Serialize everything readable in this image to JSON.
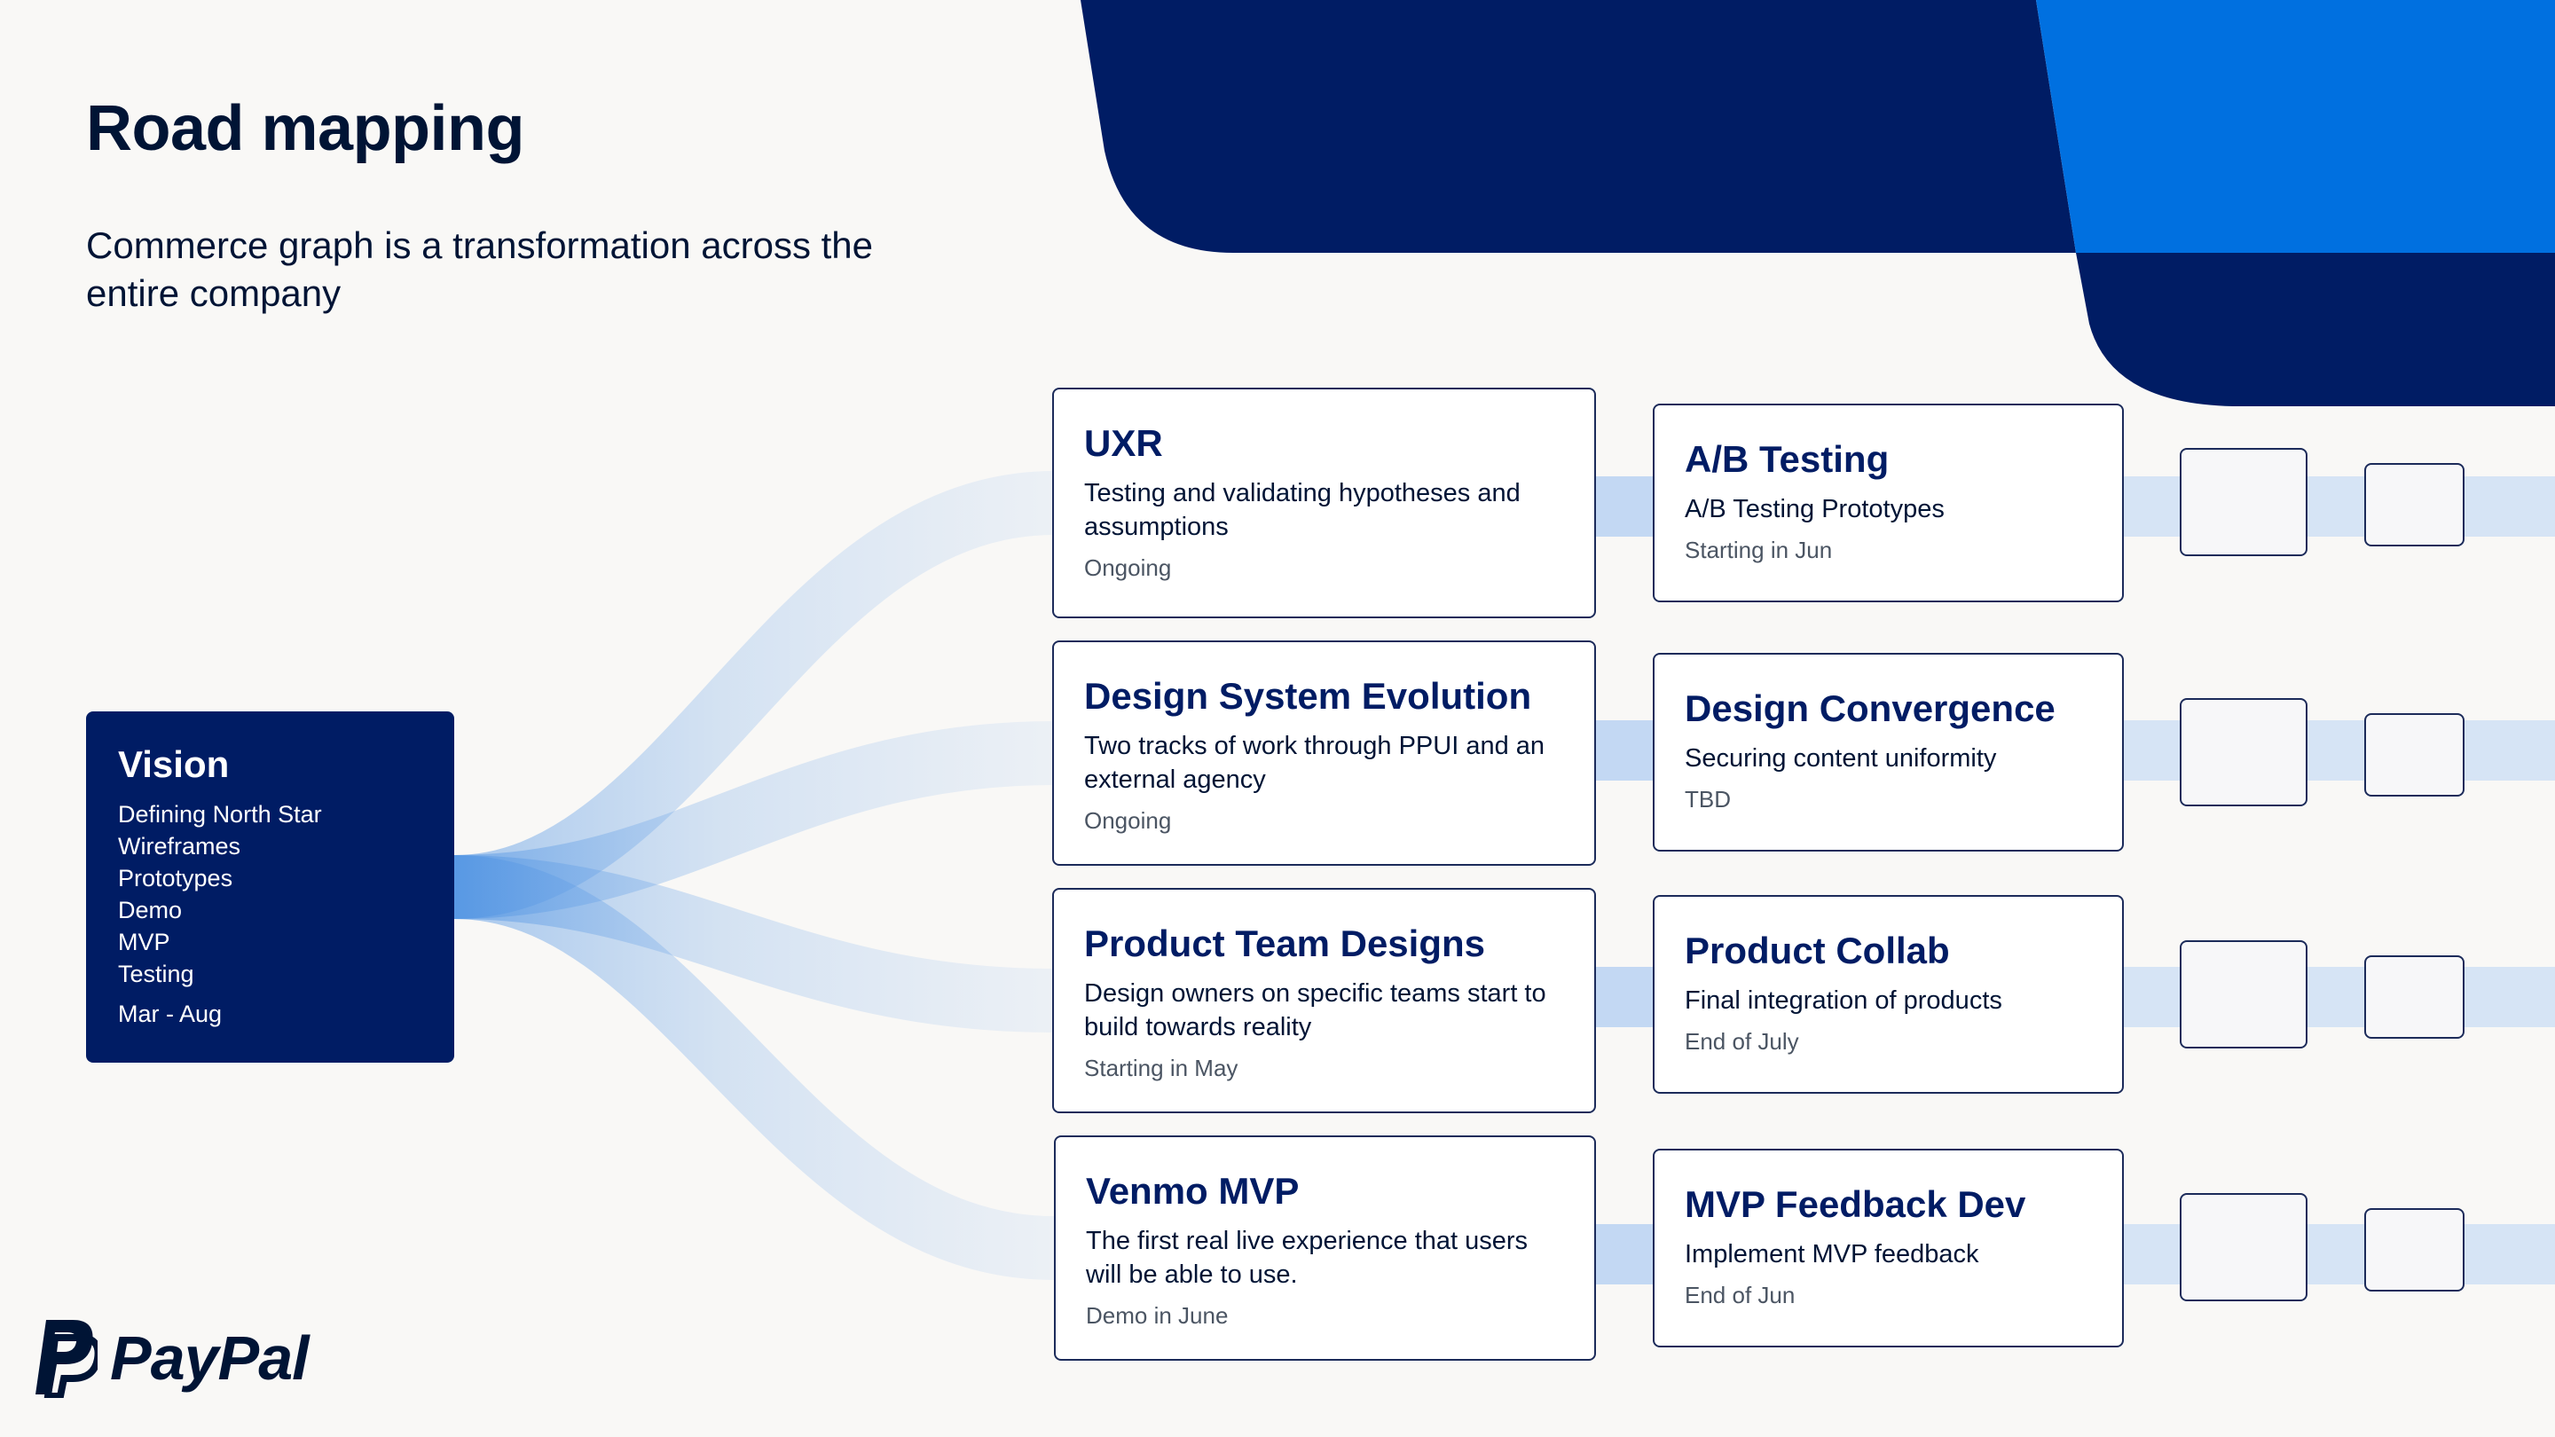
{
  "header": {
    "title": "Road mapping",
    "subtitle": "Commerce graph is a transformation across the entire company"
  },
  "vision": {
    "title": "Vision",
    "items": [
      "Defining North Star",
      "Wireframes",
      "Prototypes",
      "Demo",
      "MVP",
      "Testing"
    ],
    "date": "Mar - Aug"
  },
  "tracks": [
    {
      "title": "UXR",
      "description": "Testing and validating hypotheses and assumptions",
      "status": "Ongoing",
      "next": {
        "title": "A/B Testing",
        "description": "A/B Testing Prototypes",
        "status": "Starting in Jun"
      }
    },
    {
      "title": "Design System Evolution",
      "description": "Two tracks of work through PPUI and an external agency",
      "status": "Ongoing",
      "next": {
        "title": "Design Convergence",
        "description": "Securing content uniformity",
        "status": "TBD"
      }
    },
    {
      "title": "Product Team Designs",
      "description": "Design owners on specific teams start to build towards reality",
      "status": "Starting in May",
      "next": {
        "title": "Product Collab",
        "description": "Final integration of products",
        "status": "End of July"
      }
    },
    {
      "title": "Venmo MVP",
      "description": "The first real live experience that users will be able to use.",
      "status": "Demo in June",
      "next": {
        "title": "MVP Feedback Dev",
        "description": "Implement MVP feedback",
        "status": "End of Jun"
      }
    }
  ],
  "brand": {
    "name": "PayPal",
    "logo_icon": "paypal-p-icon",
    "colors": {
      "navy": "#001c64",
      "blue": "#0070e0",
      "flow": "#4a90e2",
      "background": "#f9f8f6"
    }
  }
}
